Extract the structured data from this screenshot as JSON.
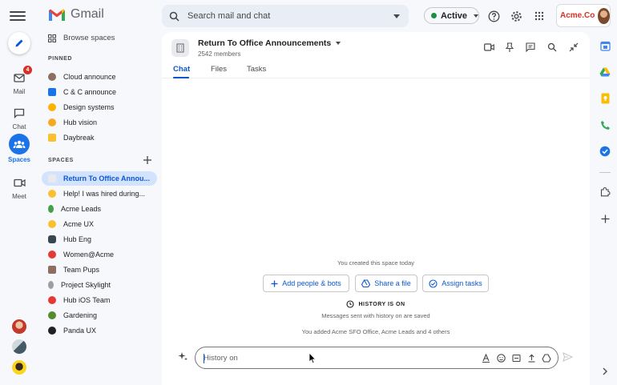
{
  "app": {
    "name": "Gmail"
  },
  "search": {
    "placeholder": "Search mail and chat"
  },
  "status": {
    "label": "Active",
    "color": "#1e8e3e"
  },
  "org": {
    "name": "Acme.Co"
  },
  "rail": {
    "items": [
      {
        "label": "Mail",
        "badge": "4"
      },
      {
        "label": "Chat"
      },
      {
        "label": "Spaces"
      },
      {
        "label": "Meet"
      }
    ]
  },
  "sidebar": {
    "browse_label": "Browse spaces",
    "pinned_header": "PINNED",
    "spaces_header": "SPACES",
    "pinned": [
      "Cloud announce",
      "C & C announce",
      "Design systems",
      "Hub vision",
      "Daybreak"
    ],
    "spaces": [
      "Return To Office Annou...",
      "Help! I was hired during...",
      "Acme Leads",
      "Acme UX",
      "Hub Eng",
      "Women@Acme",
      "Team Pups",
      "Project Skylight",
      "Hub iOS Team",
      "Gardening",
      "Panda UX"
    ]
  },
  "space": {
    "title": "Return To Office Announcements",
    "members": "2542 members"
  },
  "tabs": [
    "Chat",
    "Files",
    "Tasks"
  ],
  "conversation": {
    "created": "You created this space today",
    "actions": [
      "Add people & bots",
      "Share a file",
      "Assign tasks"
    ],
    "history_on": "HISTORY IS ON",
    "history_note": "Messages sent with history on are saved",
    "added_note": "You added Acme SFO Office, Acme Leads and 4 others"
  },
  "composer": {
    "placeholder": "History on"
  },
  "colors": {
    "accent": "#0b57d0",
    "selected_bg": "#d3e3fd",
    "badge": "#d93025"
  }
}
